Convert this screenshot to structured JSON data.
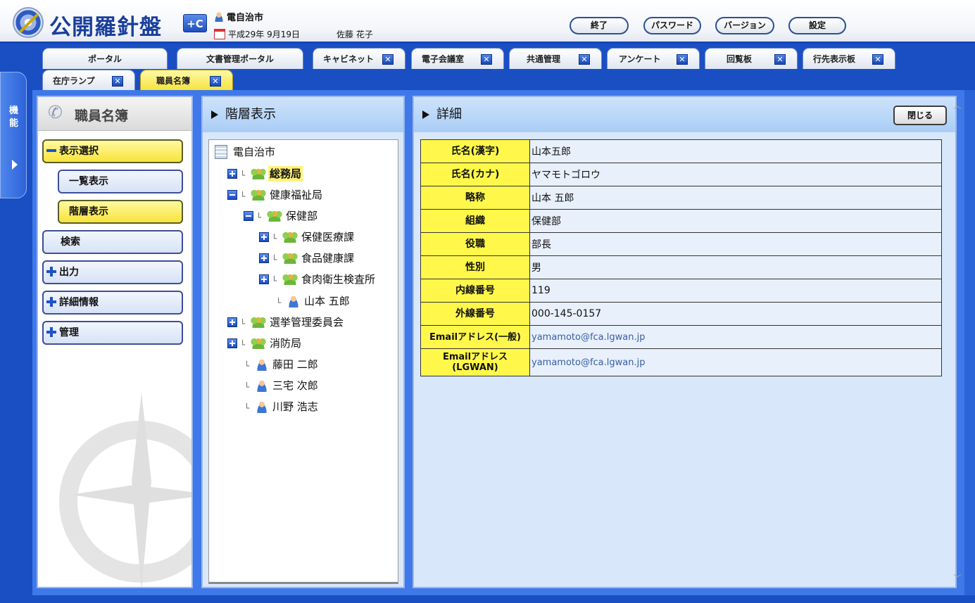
{
  "header": {
    "logo_title": "公開羅針盤",
    "logo_badge": "+C",
    "org_name": "電自治市",
    "date": "平成29年 9月19日",
    "user_name": "佐藤 花子",
    "buttons": {
      "exit": "終了",
      "password": "パスワード",
      "version": "バージョン",
      "settings": "設定"
    }
  },
  "side_strip": {
    "label": "機能"
  },
  "tabs": [
    {
      "label": "ポータル",
      "closable": false
    },
    {
      "label": "文書管理ポータル",
      "closable": false
    },
    {
      "label": "キャビネット",
      "closable": true
    },
    {
      "label": "電子会議室",
      "closable": true
    },
    {
      "label": "共通管理",
      "closable": true
    },
    {
      "label": "アンケート",
      "closable": true
    },
    {
      "label": "回覧板",
      "closable": true
    },
    {
      "label": "行先表示板",
      "closable": true
    },
    {
      "label": "在庁ランプ",
      "closable": true
    },
    {
      "label": "職員名簿",
      "closable": true,
      "active": true
    }
  ],
  "left_panel": {
    "title": "職員名簿",
    "menu": {
      "display_select": "表示選択",
      "list_view": "一覧表示",
      "hierarchy_view": "階層表示",
      "search": "検索",
      "output": "出力",
      "detail_info": "詳細情報",
      "admin": "管理"
    }
  },
  "tree_panel": {
    "title": "階層表示",
    "nodes": [
      {
        "label": "電自治市"
      },
      {
        "label": "総務局"
      },
      {
        "label": "健康福祉局"
      },
      {
        "label": "保健部"
      },
      {
        "label": "保健医療課"
      },
      {
        "label": "食品健康課"
      },
      {
        "label": "食肉衛生検査所"
      },
      {
        "label": "山本 五郎"
      },
      {
        "label": "選挙管理委員会"
      },
      {
        "label": "消防局"
      },
      {
        "label": "藤田 二郎"
      },
      {
        "label": "三宅 次郎"
      },
      {
        "label": "川野 浩志"
      }
    ]
  },
  "detail_panel": {
    "title": "詳細",
    "close_label": "閉じる",
    "rows": [
      {
        "key": "氏名(漢字)",
        "value": "山本五郎"
      },
      {
        "key": "氏名(カナ)",
        "value": "ヤマモトゴロウ"
      },
      {
        "key": "略称",
        "value": "山本 五郎"
      },
      {
        "key": "組織",
        "value": "保健部"
      },
      {
        "key": "役職",
        "value": "部長"
      },
      {
        "key": "性別",
        "value": "男"
      },
      {
        "key": "内線番号",
        "value": "119"
      },
      {
        "key": "外線番号",
        "value": "000-145-0157"
      },
      {
        "key": "Emailアドレス(一般)",
        "value": "yamamoto@fca.lgwan.jp"
      },
      {
        "key": "Emailアドレス(LGWAN)",
        "value": "yamamoto@fca.lgwan.jp"
      }
    ]
  },
  "colors": {
    "accent": "#1a4fc4",
    "highlight": "#f7e33b",
    "panel": "#d9e7fb"
  }
}
